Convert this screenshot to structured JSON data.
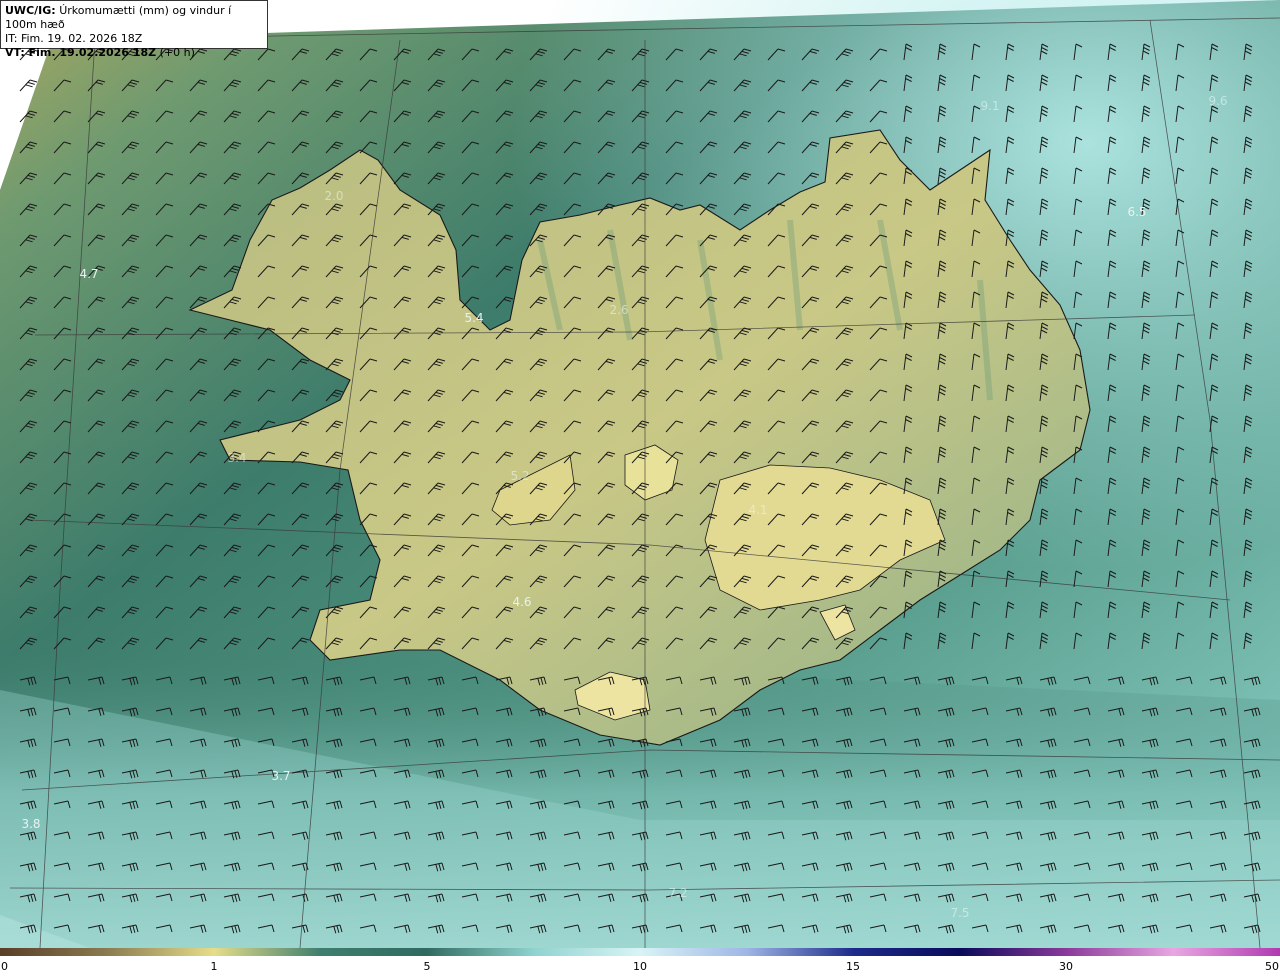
{
  "header": {
    "model": "UWC/IG:",
    "title": "Úrkomumætti (mm) og vindur í 100m hæð",
    "issue_time": "IT: Fim. 19. 02. 2026 18Z",
    "valid_prefix": "VT: Fim. 19.02.2026 18Z",
    "valid_offset": "(+0 h)"
  },
  "value_labels": [
    {
      "text": "4.7",
      "style": "normal"
    },
    {
      "text": "5.4",
      "style": "normal"
    },
    {
      "text": "2.6",
      "style": "faint"
    },
    {
      "text": "9.1",
      "style": "faint"
    },
    {
      "text": "9.6",
      "style": "faint"
    },
    {
      "text": "6.5",
      "style": "normal"
    },
    {
      "text": "2.0",
      "style": "faint"
    },
    {
      "text": "3.4",
      "style": "faint"
    },
    {
      "text": "5.2",
      "style": "faint"
    },
    {
      "text": "4.6",
      "style": "normal"
    },
    {
      "text": "4.1",
      "style": "faint"
    },
    {
      "text": "3.7",
      "style": "normal"
    },
    {
      "text": "3.8",
      "style": "normal"
    },
    {
      "text": "7.2",
      "style": "faint"
    },
    {
      "text": "7.5",
      "style": "faint"
    }
  ],
  "colorbar": {
    "ticks": [
      "0",
      "1",
      "5",
      "10",
      "15",
      "30",
      "50"
    ],
    "colors": [
      "#5a3e28",
      "#8a7a50",
      "#e6dd8a",
      "#3f7f6e",
      "#2f6a60",
      "#8fd3cf",
      "#d8f4f6",
      "#9fb6e6",
      "#1d2b8a",
      "#0a0a5a",
      "#8a3a9a",
      "#e8a6e2",
      "#b03ab0"
    ]
  },
  "colors": {
    "sea_dark": "#2f6b60",
    "sea_mid": "#4f8e78",
    "sea_light": "#8fd0c8",
    "land_low": "#7aa078",
    "land_high": "#e0d890",
    "coastline": "#1a1a1a",
    "grid": "#3a3a3a",
    "wind_barb": "#1a1a1a"
  }
}
